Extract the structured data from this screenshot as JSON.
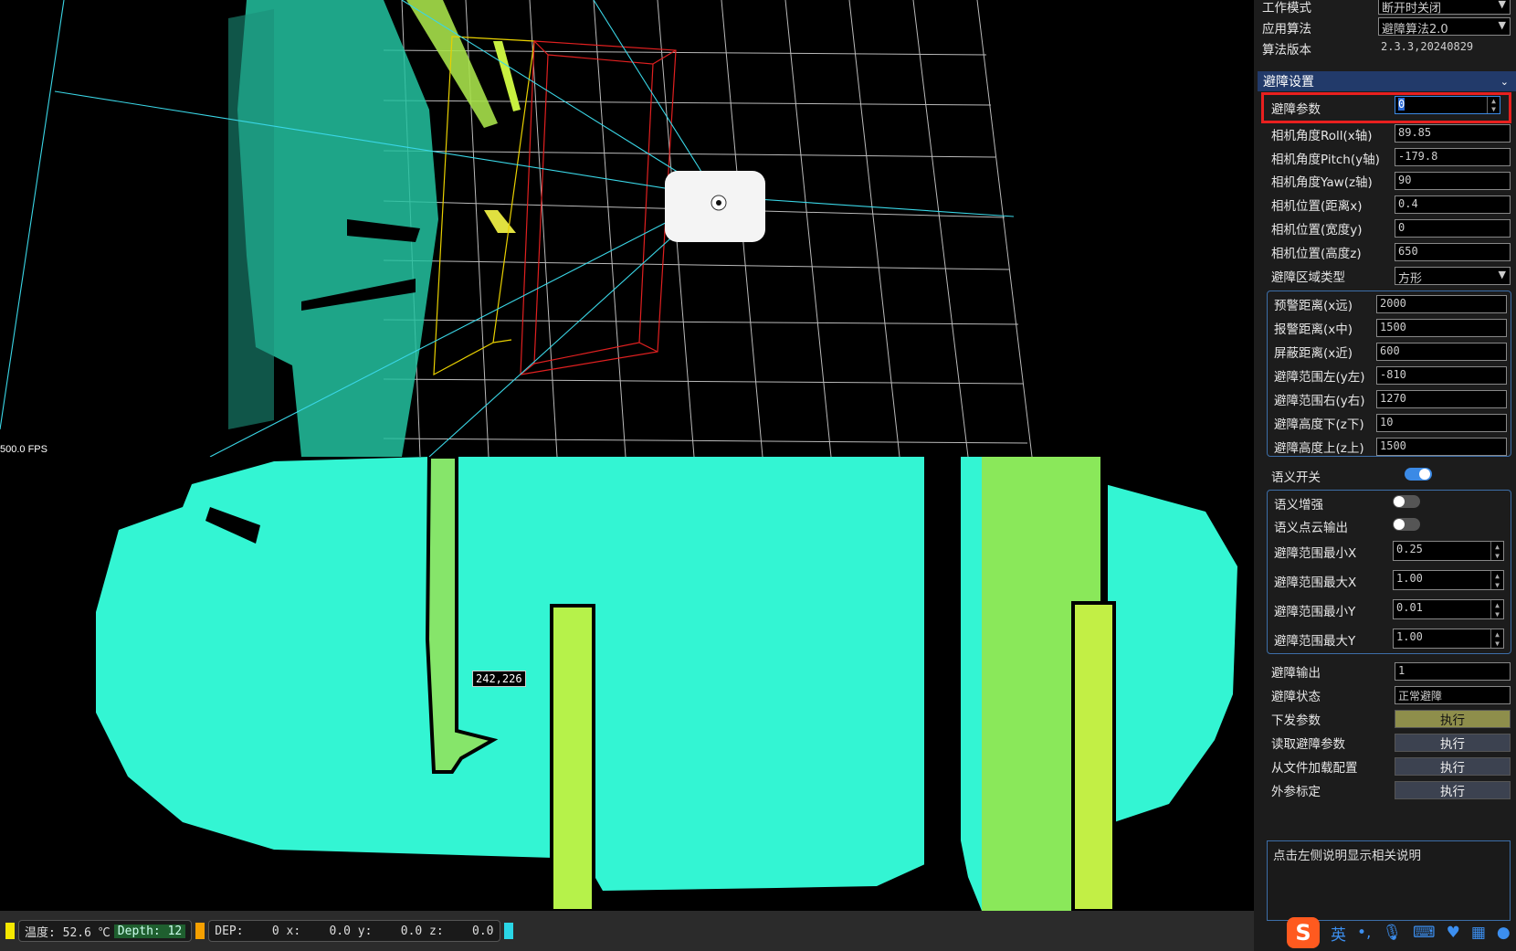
{
  "viewport3d": {
    "fps_label": "500.0 FPS"
  },
  "depth_view": {
    "cursor_readout": "242,226"
  },
  "statusbar": {
    "temperature": "温度: 52.6 ℃",
    "depth": "Depth: 12",
    "readout": "DEP:    0 x:    0.0 y:    0.0 z:    0.0"
  },
  "panel": {
    "top_rows": [
      {
        "label": "工作模式",
        "value": "断开时关闭"
      },
      {
        "label": "应用算法",
        "value": "避障算法2.0"
      },
      {
        "label": "算法版本",
        "value": "2.3.3,20240829"
      }
    ],
    "section_title": "避障设置",
    "obstacle_param": {
      "label": "避障参数",
      "value": "0"
    },
    "camera_rows": [
      {
        "label": "相机角度Roll(x轴)",
        "value": "89.85"
      },
      {
        "label": "相机角度Pitch(y轴)",
        "value": "-179.8"
      },
      {
        "label": "相机角度Yaw(z轴)",
        "value": "90"
      },
      {
        "label": "相机位置(距离x)",
        "value": "0.4"
      },
      {
        "label": "相机位置(宽度y)",
        "value": "0"
      },
      {
        "label": "相机位置(高度z)",
        "value": "650"
      }
    ],
    "area_type": {
      "label": "避障区域类型",
      "value": "方形"
    },
    "area_rows": [
      {
        "label": "预警距离(x远)",
        "value": "2000"
      },
      {
        "label": "报警距离(x中)",
        "value": "1500"
      },
      {
        "label": "屏蔽距离(x近)",
        "value": "600"
      },
      {
        "label": "避障范围左(y左)",
        "value": "-810"
      },
      {
        "label": "避障范围右(y右)",
        "value": "1270"
      },
      {
        "label": "避障高度下(z下)",
        "value": "10"
      },
      {
        "label": "避障高度上(z上)",
        "value": "1500"
      }
    ],
    "semantic_switch": {
      "label": "语义开关",
      "on": true
    },
    "semantic_rows": [
      {
        "label": "语义增强",
        "on": false
      },
      {
        "label": "语义点云输出",
        "on": false
      }
    ],
    "range_rows": [
      {
        "label": "避障范围最小X",
        "value": "0.25"
      },
      {
        "label": "避障范围最大X",
        "value": "1.00"
      },
      {
        "label": "避障范围最小Y",
        "value": "0.01"
      },
      {
        "label": "避障范围最大Y",
        "value": "1.00"
      }
    ],
    "output": {
      "label": "避障输出",
      "value": "1"
    },
    "state": {
      "label": "避障状态",
      "value": "正常避障"
    },
    "actions": [
      {
        "label": "下发参数",
        "button": "执行"
      },
      {
        "label": "读取避障参数",
        "button": "执行"
      },
      {
        "label": "从文件加载配置",
        "button": "执行"
      },
      {
        "label": "外参标定",
        "button": "执行"
      }
    ],
    "help_text": "点击左侧说明显示相关说明"
  },
  "ime": {
    "logo": "S",
    "mode": "英",
    "punct": "•,"
  }
}
